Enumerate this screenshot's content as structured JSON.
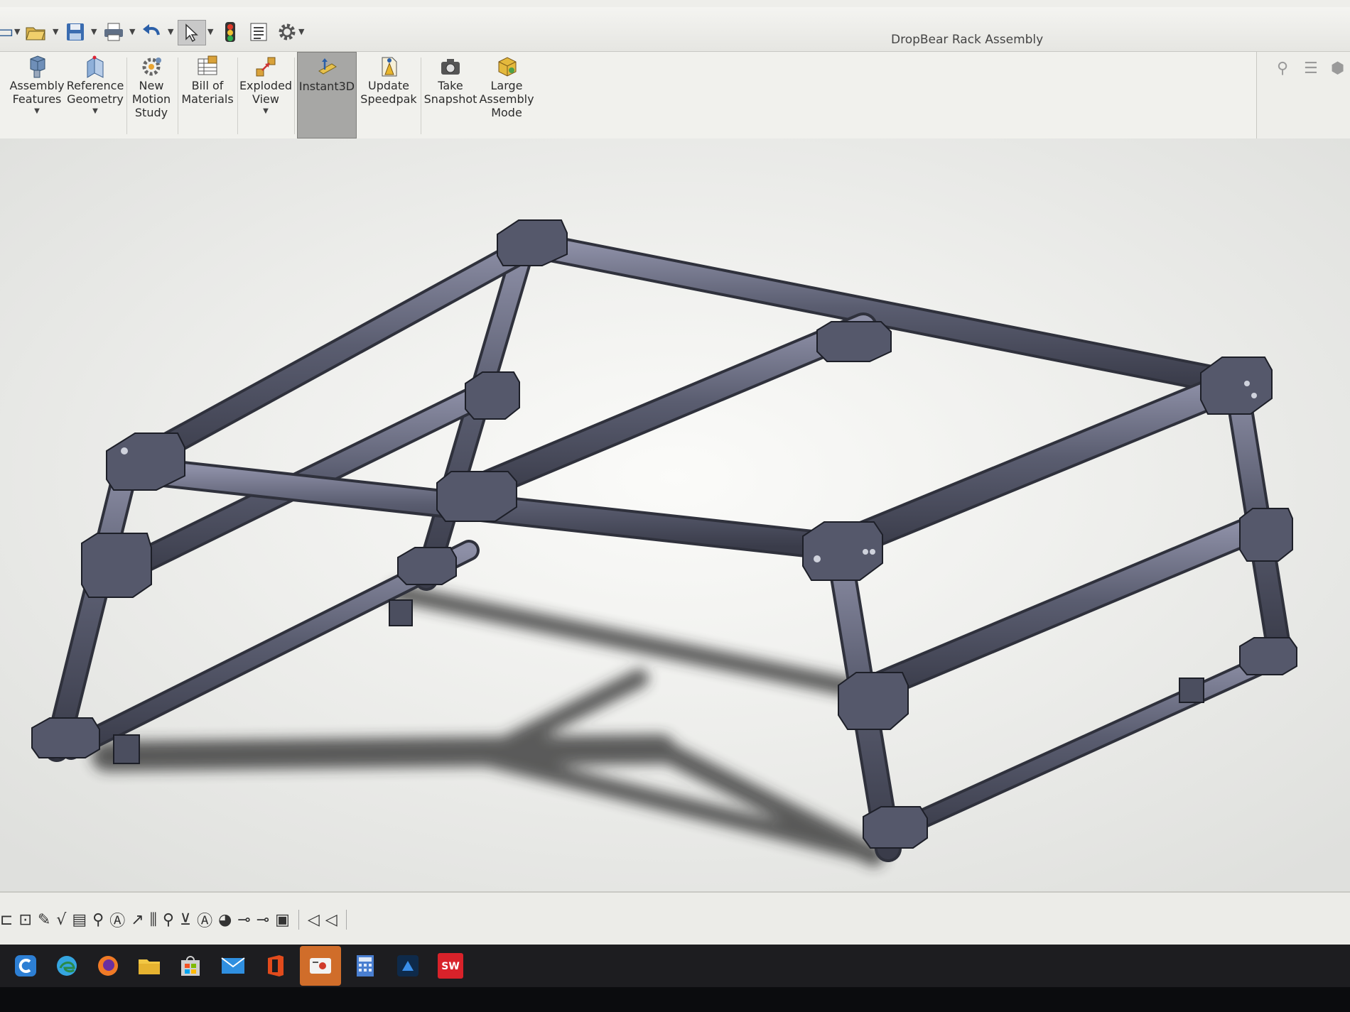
{
  "window": {
    "title": "DropBear Rack Assembly"
  },
  "quick_access": [
    {
      "name": "new-icon",
      "glyph": "▭"
    },
    {
      "name": "open-icon",
      "glyph": "📂"
    },
    {
      "name": "save-icon",
      "glyph": "💾"
    },
    {
      "name": "print-icon",
      "glyph": "🖨"
    },
    {
      "name": "undo-icon",
      "glyph": "↶"
    },
    {
      "name": "select-icon",
      "glyph": "↖"
    },
    {
      "name": "rebuild-icon",
      "glyph": "🚦"
    },
    {
      "name": "file-properties-icon",
      "glyph": "☰"
    },
    {
      "name": "options-icon",
      "glyph": "⚙"
    }
  ],
  "ribbon": {
    "tools": [
      {
        "id": "assembly-features",
        "label": "Assembly\nFeatures",
        "icon": "assembly-features-icon"
      },
      {
        "id": "reference-geometry",
        "label": "Reference\nGeometry",
        "icon": "reference-geometry-icon"
      },
      {
        "id": "new-motion-study",
        "label": "New\nMotion\nStudy",
        "icon": "motion-study-icon"
      },
      {
        "id": "bill-of-materials",
        "label": "Bill of\nMaterials",
        "icon": "bill-of-materials-icon"
      },
      {
        "id": "exploded-view",
        "label": "Exploded\nView",
        "icon": "exploded-view-icon"
      },
      {
        "id": "instant3d",
        "label": "Instant3D",
        "icon": "instant3d-icon"
      },
      {
        "id": "update-speedpak",
        "label": "Update\nSpeedpak",
        "icon": "speedpak-icon"
      },
      {
        "id": "take-snapshot",
        "label": "Take\nSnapshot",
        "icon": "camera-icon"
      },
      {
        "id": "large-assembly-mode",
        "label": "Large\nAssembly\nMode",
        "icon": "large-assembly-icon"
      }
    ],
    "active_tool": "Instant3D"
  },
  "ribbon_right": [
    {
      "name": "search-icon",
      "glyph": "🔍"
    },
    {
      "name": "list-icon",
      "glyph": "☰"
    },
    {
      "name": "cube-icon",
      "glyph": "⬡"
    }
  ],
  "heads_up_toolbar": [
    "zoom-to-fit-icon",
    "zoom-to-area-icon",
    "previous-view-icon",
    "section-view-icon",
    "dynamic-annotation-icon",
    "view-orientation-icon",
    "display-style-icon",
    "hide-show-items-icon",
    "edit-appearance-icon",
    "apply-scene-icon",
    "view-settings-icon"
  ],
  "sketch_toolbar": [
    "⊏",
    "⊡",
    "✎",
    "√",
    "▤",
    "⚲",
    "Ⓐ",
    "↗",
    "⫼",
    "⚲",
    "⊻",
    "Ⓐ",
    "◕",
    "⊸",
    "⊸",
    "▣",
    "◁",
    "◁"
  ],
  "model": {
    "name": "DropBear Rack Assembly",
    "color": "#4a4d5c"
  },
  "taskbar": [
    {
      "name": "cortana-icon",
      "glyph": "C",
      "color": "#2d7fd4"
    },
    {
      "name": "edge-icon",
      "glyph": "◐",
      "color": "#35a5e0"
    },
    {
      "name": "firefox-icon",
      "glyph": "◉",
      "color": "#f07a26"
    },
    {
      "name": "file-explorer-icon",
      "glyph": "▬",
      "color": "#f2c744"
    },
    {
      "name": "store-icon",
      "glyph": "▦",
      "color": "#cfcfcf"
    },
    {
      "name": "mail-icon",
      "glyph": "✉",
      "color": "#2f8fe0"
    },
    {
      "name": "office-icon",
      "glyph": "▮",
      "color": "#e24b1c"
    },
    {
      "name": "snipping-tool-icon",
      "glyph": "✂",
      "color": "#ffffff"
    },
    {
      "name": "calculator-icon",
      "glyph": "▦",
      "color": "#4a7fd1"
    },
    {
      "name": "photoshop-icon",
      "glyph": "⧉",
      "color": "#3a8ee8"
    },
    {
      "name": "solidworks-icon",
      "glyph": "SW",
      "color": "#d8222a"
    }
  ],
  "taskbar_solidworks_badge": "SW"
}
